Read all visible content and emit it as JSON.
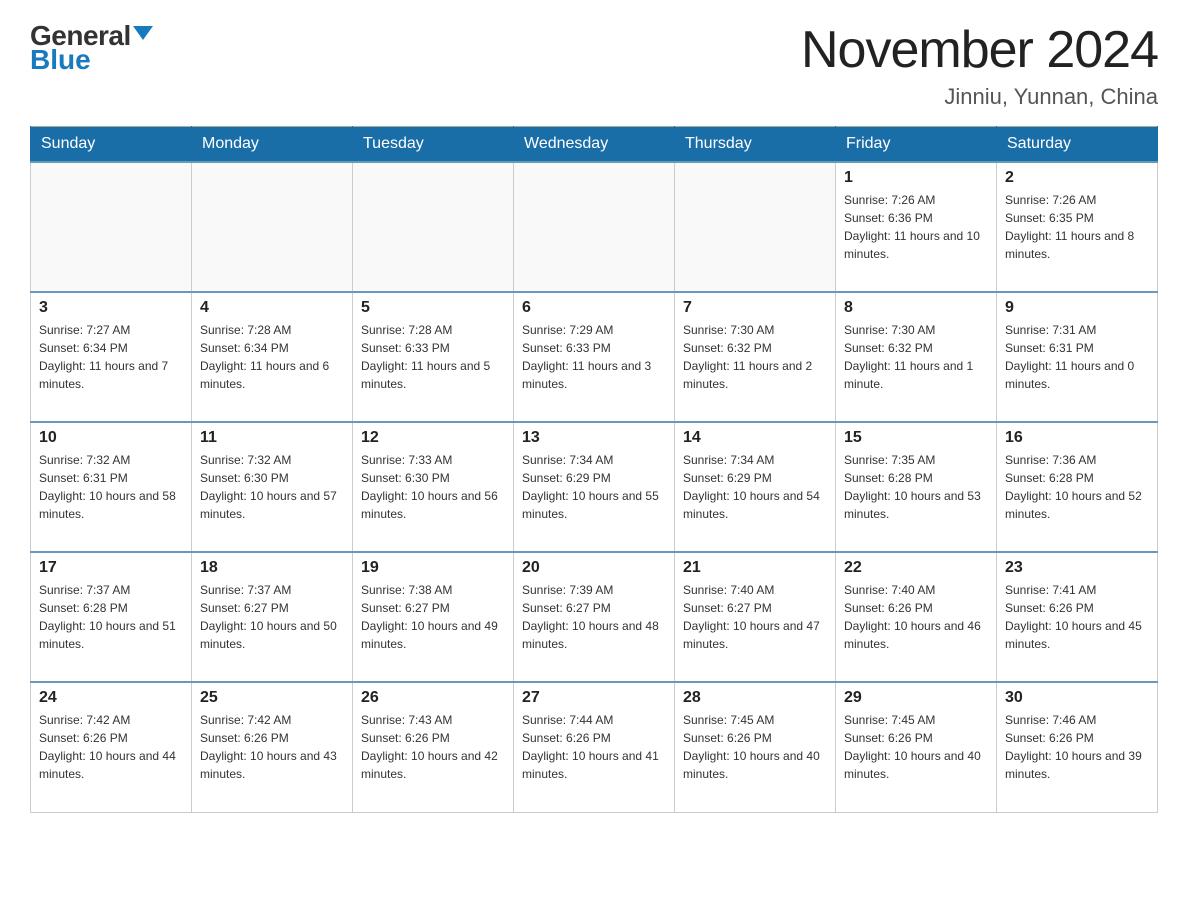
{
  "header": {
    "logo_general": "General",
    "logo_blue": "Blue",
    "month_title": "November 2024",
    "location": "Jinniu, Yunnan, China"
  },
  "days_of_week": [
    "Sunday",
    "Monday",
    "Tuesday",
    "Wednesday",
    "Thursday",
    "Friday",
    "Saturday"
  ],
  "weeks": [
    [
      {
        "day": "",
        "info": ""
      },
      {
        "day": "",
        "info": ""
      },
      {
        "day": "",
        "info": ""
      },
      {
        "day": "",
        "info": ""
      },
      {
        "day": "",
        "info": ""
      },
      {
        "day": "1",
        "info": "Sunrise: 7:26 AM\nSunset: 6:36 PM\nDaylight: 11 hours and 10 minutes."
      },
      {
        "day": "2",
        "info": "Sunrise: 7:26 AM\nSunset: 6:35 PM\nDaylight: 11 hours and 8 minutes."
      }
    ],
    [
      {
        "day": "3",
        "info": "Sunrise: 7:27 AM\nSunset: 6:34 PM\nDaylight: 11 hours and 7 minutes."
      },
      {
        "day": "4",
        "info": "Sunrise: 7:28 AM\nSunset: 6:34 PM\nDaylight: 11 hours and 6 minutes."
      },
      {
        "day": "5",
        "info": "Sunrise: 7:28 AM\nSunset: 6:33 PM\nDaylight: 11 hours and 5 minutes."
      },
      {
        "day": "6",
        "info": "Sunrise: 7:29 AM\nSunset: 6:33 PM\nDaylight: 11 hours and 3 minutes."
      },
      {
        "day": "7",
        "info": "Sunrise: 7:30 AM\nSunset: 6:32 PM\nDaylight: 11 hours and 2 minutes."
      },
      {
        "day": "8",
        "info": "Sunrise: 7:30 AM\nSunset: 6:32 PM\nDaylight: 11 hours and 1 minute."
      },
      {
        "day": "9",
        "info": "Sunrise: 7:31 AM\nSunset: 6:31 PM\nDaylight: 11 hours and 0 minutes."
      }
    ],
    [
      {
        "day": "10",
        "info": "Sunrise: 7:32 AM\nSunset: 6:31 PM\nDaylight: 10 hours and 58 minutes."
      },
      {
        "day": "11",
        "info": "Sunrise: 7:32 AM\nSunset: 6:30 PM\nDaylight: 10 hours and 57 minutes."
      },
      {
        "day": "12",
        "info": "Sunrise: 7:33 AM\nSunset: 6:30 PM\nDaylight: 10 hours and 56 minutes."
      },
      {
        "day": "13",
        "info": "Sunrise: 7:34 AM\nSunset: 6:29 PM\nDaylight: 10 hours and 55 minutes."
      },
      {
        "day": "14",
        "info": "Sunrise: 7:34 AM\nSunset: 6:29 PM\nDaylight: 10 hours and 54 minutes."
      },
      {
        "day": "15",
        "info": "Sunrise: 7:35 AM\nSunset: 6:28 PM\nDaylight: 10 hours and 53 minutes."
      },
      {
        "day": "16",
        "info": "Sunrise: 7:36 AM\nSunset: 6:28 PM\nDaylight: 10 hours and 52 minutes."
      }
    ],
    [
      {
        "day": "17",
        "info": "Sunrise: 7:37 AM\nSunset: 6:28 PM\nDaylight: 10 hours and 51 minutes."
      },
      {
        "day": "18",
        "info": "Sunrise: 7:37 AM\nSunset: 6:27 PM\nDaylight: 10 hours and 50 minutes."
      },
      {
        "day": "19",
        "info": "Sunrise: 7:38 AM\nSunset: 6:27 PM\nDaylight: 10 hours and 49 minutes."
      },
      {
        "day": "20",
        "info": "Sunrise: 7:39 AM\nSunset: 6:27 PM\nDaylight: 10 hours and 48 minutes."
      },
      {
        "day": "21",
        "info": "Sunrise: 7:40 AM\nSunset: 6:27 PM\nDaylight: 10 hours and 47 minutes."
      },
      {
        "day": "22",
        "info": "Sunrise: 7:40 AM\nSunset: 6:26 PM\nDaylight: 10 hours and 46 minutes."
      },
      {
        "day": "23",
        "info": "Sunrise: 7:41 AM\nSunset: 6:26 PM\nDaylight: 10 hours and 45 minutes."
      }
    ],
    [
      {
        "day": "24",
        "info": "Sunrise: 7:42 AM\nSunset: 6:26 PM\nDaylight: 10 hours and 44 minutes."
      },
      {
        "day": "25",
        "info": "Sunrise: 7:42 AM\nSunset: 6:26 PM\nDaylight: 10 hours and 43 minutes."
      },
      {
        "day": "26",
        "info": "Sunrise: 7:43 AM\nSunset: 6:26 PM\nDaylight: 10 hours and 42 minutes."
      },
      {
        "day": "27",
        "info": "Sunrise: 7:44 AM\nSunset: 6:26 PM\nDaylight: 10 hours and 41 minutes."
      },
      {
        "day": "28",
        "info": "Sunrise: 7:45 AM\nSunset: 6:26 PM\nDaylight: 10 hours and 40 minutes."
      },
      {
        "day": "29",
        "info": "Sunrise: 7:45 AM\nSunset: 6:26 PM\nDaylight: 10 hours and 40 minutes."
      },
      {
        "day": "30",
        "info": "Sunrise: 7:46 AM\nSunset: 6:26 PM\nDaylight: 10 hours and 39 minutes."
      }
    ]
  ]
}
